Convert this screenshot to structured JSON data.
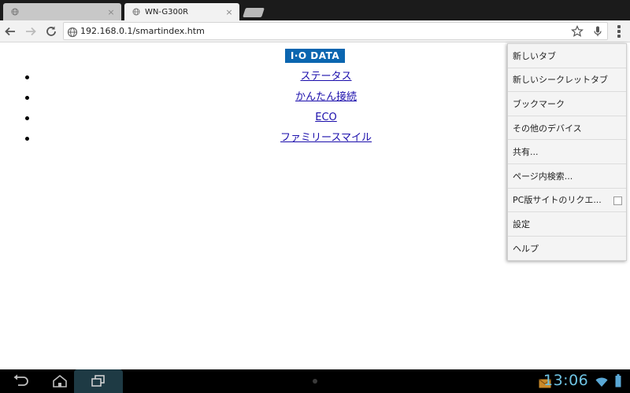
{
  "tabs": [
    {
      "title": "",
      "close_symbol": "×"
    },
    {
      "title": "WN-G300R",
      "close_symbol": "×"
    }
  ],
  "toolbar": {
    "url": "192.168.0.1/smartindex.htm"
  },
  "page": {
    "logo_text": "I·O DATA",
    "nav_links": [
      "ステータス",
      "かんたん接続",
      "ECO",
      "ファミリースマイル"
    ]
  },
  "menu": {
    "items": [
      "新しいタブ",
      "新しいシークレットタブ",
      "ブックマーク",
      "その他のデバイス",
      "共有...",
      "ページ内検索...",
      "PC版サイトのリクエ...",
      "設定",
      "ヘルプ"
    ],
    "desktop_site_checked": false
  },
  "systembar": {
    "clock": "13:06"
  },
  "colors": {
    "logo_bg": "#0b66b0",
    "link": "#1a0dab",
    "clock": "#6fc4e4",
    "status_icons": "#5aa8d6"
  },
  "icons": {
    "tab_favicon": "globe-icon",
    "back": "arrow-left-icon",
    "forward": "arrow-right-icon",
    "reload": "reload-icon",
    "bookmark": "star-icon",
    "voice": "microphone-icon",
    "menu": "overflow-menu-icon"
  }
}
